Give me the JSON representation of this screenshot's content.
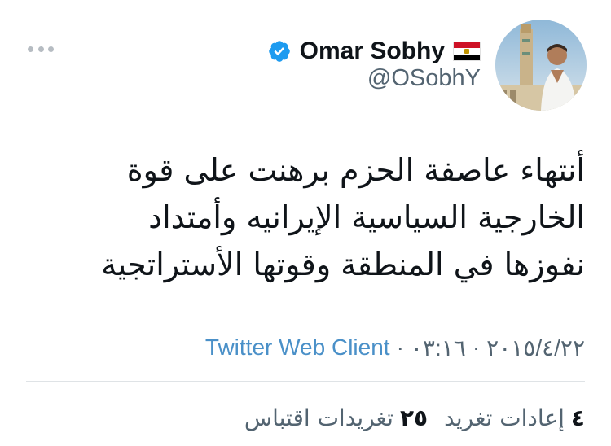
{
  "user": {
    "display_name": "Omar Sobhy",
    "handle": "@OSobhY"
  },
  "tweet": {
    "text": "أنتهاء عاصفة الحزم برهنت على قوة الخارجية السياسية الإيرانيه وأمتداد نفوزها في المنطقة وقوتها الأستراتجية"
  },
  "meta": {
    "date": "٢٠١٥/٤/٢٢",
    "separator": "·",
    "time": "٠٣:١٦",
    "client": "Twitter Web Client"
  },
  "stats": {
    "retweets_count": "٤",
    "retweets_label": "إعادات تغريد",
    "quotes_count": "٢٥",
    "quotes_label": "تغريدات اقتباس"
  },
  "colors": {
    "verified": "#1d9bf0",
    "link": "#4a90c8",
    "secondary_text": "#536471"
  }
}
